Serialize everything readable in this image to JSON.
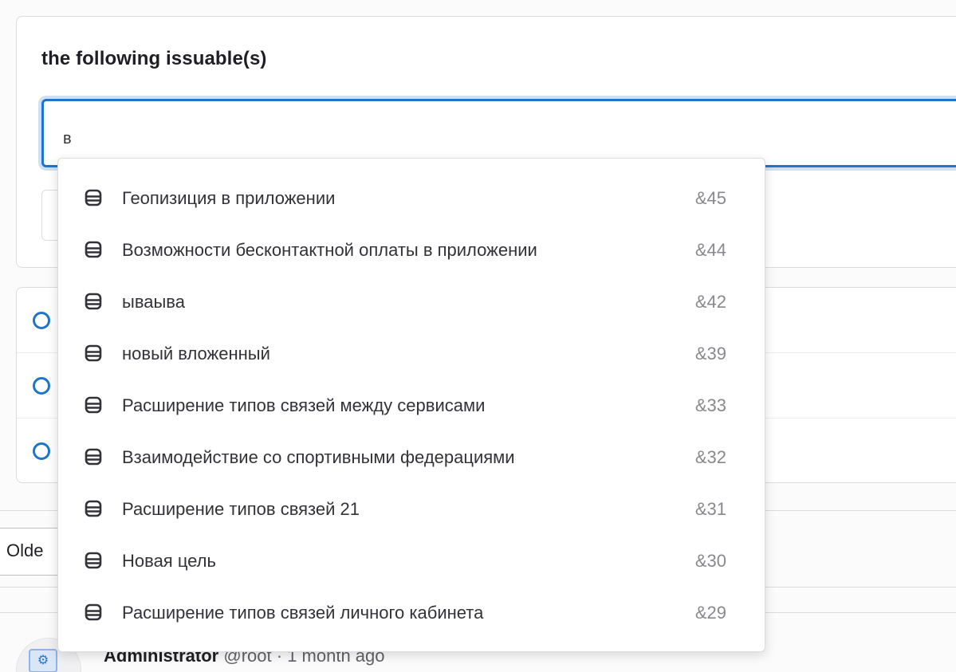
{
  "panel": {
    "heading": "the following issuable(s)",
    "search": {
      "value": "в"
    }
  },
  "sort": {
    "label": "Olde"
  },
  "note": {
    "author": "Administrator",
    "handle": "@root",
    "separator": "·",
    "time": "1 month ago"
  },
  "dropdown": {
    "items": [
      {
        "title": "Геопизиция в приложении",
        "ref": "&45",
        "icon": "epic-icon"
      },
      {
        "title": "Возможности бесконтактной оплаты в приложении",
        "ref": "&44",
        "icon": "epic-icon"
      },
      {
        "title": "ываыва",
        "ref": "&42",
        "icon": "epic-icon"
      },
      {
        "title": "новый вложенный",
        "ref": "&39",
        "icon": "epic-icon"
      },
      {
        "title": "Расширение типов связей между сервисами",
        "ref": "&33",
        "icon": "epic-icon"
      },
      {
        "title": "Взаимодействие со спортивными федерациями",
        "ref": "&32",
        "icon": "epic-icon"
      },
      {
        "title": "Расширение типов связей 21",
        "ref": "&31",
        "icon": "epic-icon"
      },
      {
        "title": "Новая цель",
        "ref": "&30",
        "icon": "epic-icon"
      },
      {
        "title": "Расширение типов связей личного кабинета",
        "ref": "&29",
        "icon": "epic-icon"
      }
    ]
  },
  "colors": {
    "accent": "#1f75cb",
    "ref_text": "#89888d"
  }
}
